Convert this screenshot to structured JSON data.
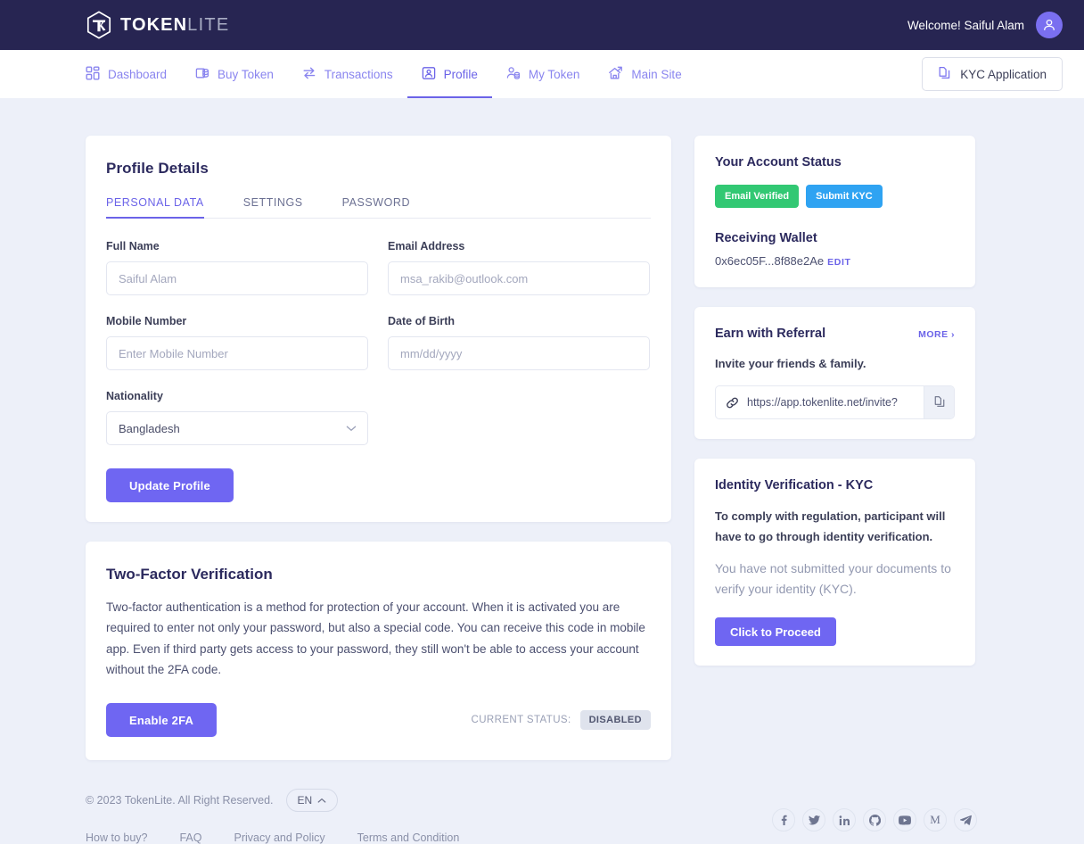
{
  "brand": {
    "name_bold": "TOKEN",
    "name_light": "LITE",
    "logo_icon": "cube-hexagon-icon"
  },
  "header": {
    "welcome": "Welcome! Saiful Alam",
    "avatar_icon": "user-avatar-icon"
  },
  "nav": {
    "items": [
      {
        "label": "Dashboard",
        "icon": "grid-dashboard-icon",
        "active": false
      },
      {
        "label": "Buy Token",
        "icon": "coins-stack-icon",
        "active": false
      },
      {
        "label": "Transactions",
        "icon": "transfer-arrows-icon",
        "active": false
      },
      {
        "label": "Profile",
        "icon": "user-card-icon",
        "active": true
      },
      {
        "label": "My Token",
        "icon": "user-coins-icon",
        "active": false
      },
      {
        "label": "Main Site",
        "icon": "home-arrow-icon",
        "active": false
      }
    ],
    "kyc_button": {
      "label": "KYC Application",
      "icon": "documents-copy-icon"
    }
  },
  "profile": {
    "title": "Profile Details",
    "tabs": [
      {
        "label": "PERSONAL DATA",
        "active": true
      },
      {
        "label": "SETTINGS",
        "active": false
      },
      {
        "label": "PASSWORD",
        "active": false
      }
    ],
    "fields": {
      "full_name": {
        "label": "Full Name",
        "value": "",
        "placeholder": "Saiful Alam"
      },
      "email": {
        "label": "Email Address",
        "value": "",
        "placeholder": "msa_rakib@outlook.com"
      },
      "mobile": {
        "label": "Mobile Number",
        "value": "",
        "placeholder": "Enter Mobile Number"
      },
      "dob": {
        "label": "Date of Birth",
        "value": "",
        "placeholder": "mm/dd/yyyy"
      },
      "nationality": {
        "label": "Nationality",
        "value": "Bangladesh",
        "options": [
          "Bangladesh"
        ]
      }
    },
    "update_button": "Update Profile"
  },
  "two_factor": {
    "title": "Two-Factor Verification",
    "description": "Two-factor authentication is a method for protection of your account. When it is activated you are required to enter not only your password, but also a special code. You can receive this code in mobile app. Even if third party gets access to your password, they still won't be able to access your account without the 2FA code.",
    "enable_button": "Enable 2FA",
    "status_label": "CURRENT STATUS:",
    "status_value": "DISABLED"
  },
  "account_status": {
    "title": "Your Account Status",
    "email_badge": "Email Verified",
    "kyc_badge": "Submit KYC",
    "wallet_title": "Receiving Wallet",
    "wallet_address": "0x6ec05F...8f88e2Ae",
    "wallet_edit": "EDIT"
  },
  "referral": {
    "title": "Earn with Referral",
    "more": "MORE ›",
    "invite_text": "Invite your friends & family.",
    "link": "https://app.tokenlite.net/invite?",
    "link_icon": "link-chain-icon",
    "copy_icon": "copy-icon"
  },
  "kyc": {
    "title": "Identity Verification - KYC",
    "description": "To comply with regulation, participant will have to go through identity verification.",
    "note": "You have not submitted your documents to verify your identity (KYC).",
    "button": "Click to Proceed"
  },
  "footer": {
    "copyright": "© 2023 TokenLite. All Right Reserved.",
    "language": "EN",
    "links": [
      "How to buy?",
      "FAQ",
      "Privacy and Policy",
      "Terms and Condition"
    ],
    "socials": [
      {
        "name": "facebook-icon",
        "glyph": "f"
      },
      {
        "name": "twitter-icon",
        "glyph": "\u0000"
      },
      {
        "name": "linkedin-icon",
        "glyph": "in"
      },
      {
        "name": "github-icon",
        "glyph": "\u0000"
      },
      {
        "name": "youtube-icon",
        "glyph": "\u0000"
      },
      {
        "name": "medium-icon",
        "glyph": "M"
      },
      {
        "name": "telegram-icon",
        "glyph": "\u0000"
      }
    ]
  },
  "colors": {
    "topbar": "#272552",
    "accent": "#6f66f2",
    "nav_link": "#8a85ef",
    "green": "#32c873",
    "blue": "#2fa3f2",
    "page_bg": "#edf0f9"
  }
}
